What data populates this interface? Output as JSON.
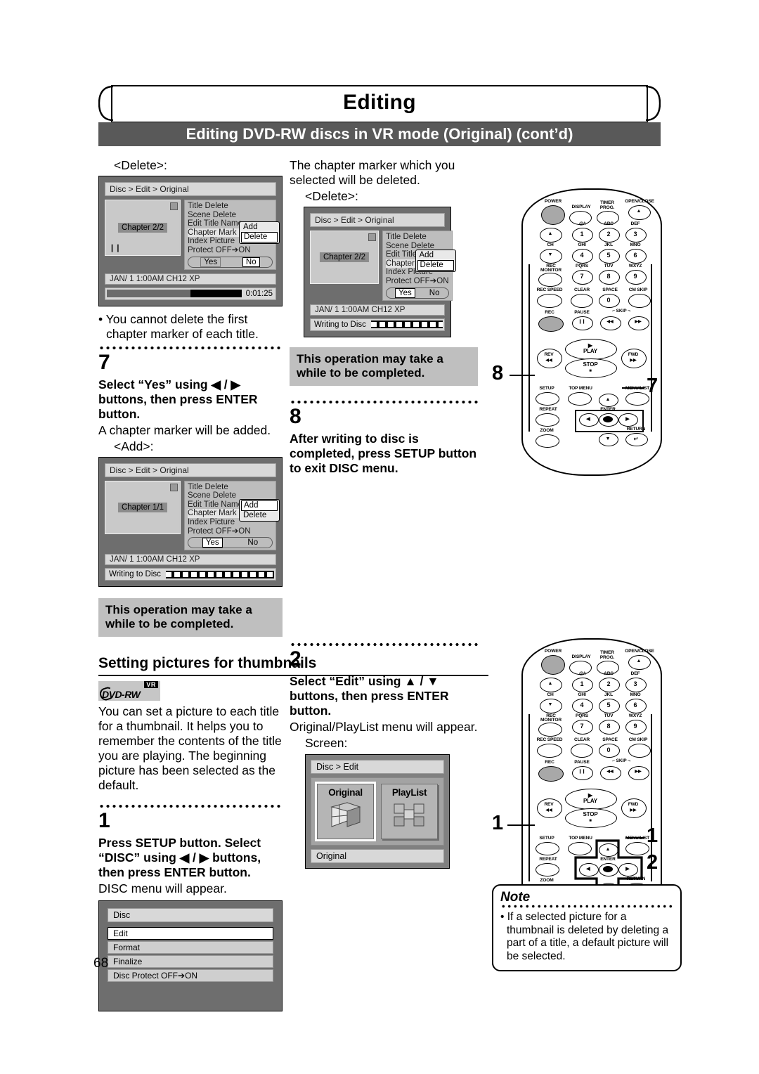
{
  "header": {
    "title": "Editing",
    "subtitle": "Editing DVD-RW discs in VR mode (Original) (cont’d)"
  },
  "page_number": "68",
  "left_column": {
    "delete_caption": "<Delete>:",
    "screen_delete": {
      "breadcrumb": "Disc > Edit > Original",
      "chapter_label": "Chapter 2/2",
      "menu_items": [
        "Title Delete",
        "Scene Delete",
        "Edit Title Name",
        "Chapter Mark",
        "Index Picture",
        "Protect OFF➔ON"
      ],
      "popup_items": [
        "Add",
        "Delete"
      ],
      "popup_selected": "Delete",
      "yes_label": "Yes",
      "no_label": "No",
      "yes_no_selected": "No",
      "status": "JAN/ 1   1:00AM  CH12    XP",
      "time": "0:01:25"
    },
    "note_bullet": "• You cannot delete the first chapter marker of each title.",
    "step7": {
      "number": "7",
      "bold": "Select “Yes” using ◀ / ▶ buttons, then press ENTER button.",
      "body": "A chapter marker will be added.",
      "caption": "<Add>:"
    },
    "screen_add": {
      "breadcrumb": "Disc > Edit > Original",
      "chapter_label": "Chapter 1/1",
      "menu_items": [
        "Title Delete",
        "Scene Delete",
        "Edit Title Name",
        "Chapter Mark",
        "Index Picture",
        "Protect OFF➔ON"
      ],
      "popup_items": [
        "Add",
        "Delete"
      ],
      "popup_selected": "Add",
      "yes_label": "Yes",
      "no_label": "No",
      "yes_no_selected": "Yes",
      "status": "JAN/ 1   1:00AM  CH12    XP",
      "progress_label": "Writing to Disc"
    },
    "operation_notice": "This operation may take a while to be completed."
  },
  "middle_column": {
    "intro": "The chapter marker which you selected will be deleted.",
    "delete_caption": "<Delete>:",
    "screen_delete": {
      "breadcrumb": "Disc > Edit > Original",
      "chapter_label": "Chapter 2/2",
      "menu_items": [
        "Title Delete",
        "Scene Delete",
        "Edit Title Name",
        "Chapter Mark",
        "Index Picture",
        "Protect OFF➔ON"
      ],
      "popup_items": [
        "Add",
        "Delete"
      ],
      "popup_selected": "Delete",
      "yes_label": "Yes",
      "no_label": "No",
      "yes_no_selected": "Yes",
      "status": "JAN/ 1   1:00AM  CH12    XP",
      "progress_label": "Writing to Disc"
    },
    "operation_notice": "This operation may take a while to be completed.",
    "step8": {
      "number": "8",
      "bold": "After writing to disc is completed, press SETUP button to exit DISC menu."
    }
  },
  "section": {
    "heading": "Setting pictures for thumbnails",
    "logo": {
      "format": "DVD-RW",
      "mode": "VR"
    },
    "intro": "You can set a picture to each title for a thumbnail. It helps you to remember the contents of the title you are playing. The beginning picture has been selected as the default.",
    "step1": {
      "number": "1",
      "bold": "Press SETUP button. Select “DISC” using ◀ / ▶ buttons, then press ENTER button.",
      "body": "DISC menu will appear."
    },
    "disc_menu": {
      "title": "Disc",
      "items": [
        "Edit",
        "Format",
        "Finalize",
        "Disc Protect OFF➔ON"
      ],
      "selected": "Edit"
    },
    "step2": {
      "number": "2",
      "bold": "Select “Edit” using ▲ / ▼ buttons, then press ENTER button.",
      "body": "Original/PlayList menu will appear.",
      "caption": "Screen:"
    },
    "original_playlist": {
      "breadcrumb": "Disc > Edit",
      "cards": [
        "Original",
        "PlayList"
      ],
      "selected": "Original",
      "footer": "Original"
    }
  },
  "note": {
    "title": "Note",
    "text": "• If a selected picture for a thumbnail is deleted by deleting a part of a title, a default picture will be selected."
  },
  "remote": {
    "labels_top": [
      "POWER",
      "DISPLAY",
      "TIMER PROG.",
      "OPEN/CLOSE"
    ],
    "keypad": [
      {
        "label": ".@/:",
        "num": "1"
      },
      {
        "label": "ABC",
        "num": "2"
      },
      {
        "label": "DEF",
        "num": "3"
      },
      {
        "label": "GHI",
        "num": "4"
      },
      {
        "label": "JKL",
        "num": "5"
      },
      {
        "label": "MNO",
        "num": "6"
      },
      {
        "label": "PQRS",
        "num": "7"
      },
      {
        "label": "TUV",
        "num": "8"
      },
      {
        "label": "WXYZ",
        "num": "9"
      },
      {
        "label": "SPACE",
        "num": "0"
      }
    ],
    "ch_label": "CH",
    "rec_monitor": "REC MONITOR",
    "rec_speed": "REC SPEED",
    "clear": "CLEAR",
    "cm_skip": "CM SKIP",
    "rec": "REC",
    "pause": "PAUSE",
    "skip": "SKIP",
    "play": "PLAY",
    "stop": "STOP",
    "rev": "REV",
    "fwd": "FWD",
    "setup": "SETUP",
    "top_menu": "TOP MENU",
    "menu_list": "MENU/LIST",
    "repeat": "REPEAT",
    "enter": "ENTER",
    "zoom": "ZOOM",
    "return": "RETURN"
  },
  "callouts": {
    "remote1_setup": "8",
    "remote1_enter": "7",
    "remote2_setup": "1",
    "remote2_enter": "1",
    "remote2_down": "2"
  }
}
